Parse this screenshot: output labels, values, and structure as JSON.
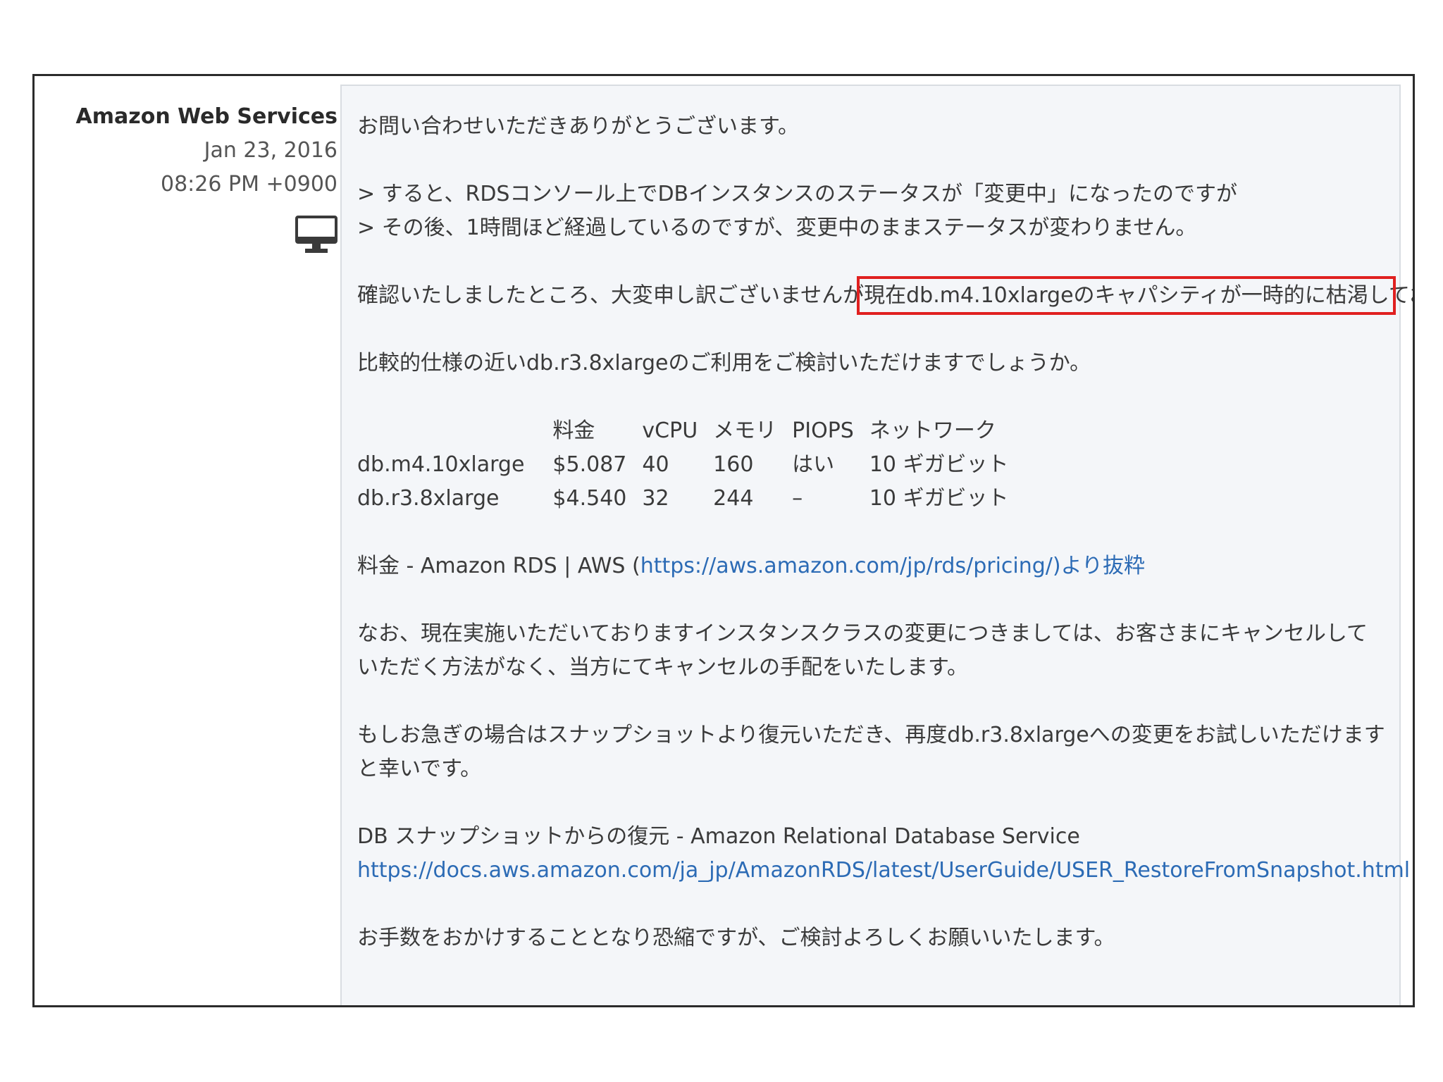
{
  "sidebar": {
    "author": "Amazon Web Services",
    "date": "Jan 23, 2016",
    "time": "08:26 PM +0900",
    "icon": "monitor-icon"
  },
  "message": {
    "greeting": "お問い合わせいただきありがとうございます。",
    "quote1": "> すると、RDSコンソール上でDBインスタンスのステータスが「変更中」になったのですが",
    "quote2": "> その後、1時間ほど経過しているのですが、変更中のままステータスが変わりません。",
    "para3_before": "確認いたしましたところ、大変申し訳ございませんが",
    "para3_highlight": "現在db.m4.10xlargeのキャパシティが一時的に枯渇し",
    "para3_after": "ており、お客さまにお使いいただけない状態となっております。",
    "suggestion": "比較的仕様の近いdb.r3.8xlargeのご利用をご検討いただけますでしょうか。",
    "table": {
      "headers": [
        "",
        "料金",
        "vCPU",
        "メモリ",
        "PIOPS",
        "ネットワーク"
      ],
      "rows": [
        [
          "db.m4.10xlarge",
          "$5.087",
          "40",
          "160",
          "はい",
          "10 ギガビット"
        ],
        [
          "db.r3.8xlarge",
          "$4.540",
          "32",
          "244",
          "–",
          "10 ギガビット"
        ]
      ]
    },
    "pricing_prefix": "料金 - Amazon RDS | AWS (",
    "pricing_link": "https://aws.amazon.com/jp/rds/pricing/)より抜粋",
    "cancel_note": "なお、現在実施いただいておりますインスタンスクラスの変更につきましては、お客さまにキャンセルしていただく方法がなく、当方にてキャンセルの手配をいたします。",
    "restore_note": "もしお急ぎの場合はスナップショットより復元いただき、再度db.r3.8xlargeへの変更をお試しいただけますと幸いです。",
    "doc_title": "DB スナップショットからの復元 - Amazon Relational Database Service",
    "doc_link": "https://docs.aws.amazon.com/ja_jp/AmazonRDS/latest/UserGuide/USER_RestoreFromSnapshot.html",
    "closing": "お手数をおかけすることとなり恐縮ですが、ご検討よろしくお願いいたします。"
  },
  "colors": {
    "highlight_border": "#e02020",
    "link": "#2c6bb5",
    "message_bg": "#f4f6f9"
  }
}
